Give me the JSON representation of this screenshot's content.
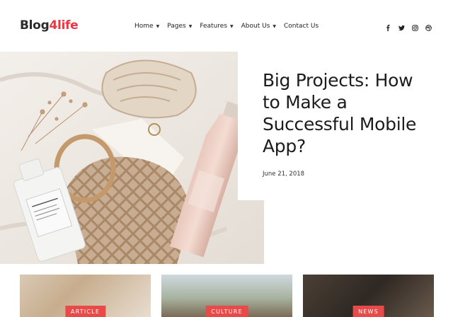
{
  "brand": {
    "name_main": "Blog",
    "name_accent": "4life",
    "accent_color": "#e63946"
  },
  "nav": [
    {
      "label": "Home",
      "has_dropdown": true
    },
    {
      "label": "Pages",
      "has_dropdown": true
    },
    {
      "label": "Features",
      "has_dropdown": true
    },
    {
      "label": "About Us",
      "has_dropdown": true
    },
    {
      "label": "Contact Us",
      "has_dropdown": false
    }
  ],
  "social": [
    {
      "icon": "facebook-icon"
    },
    {
      "icon": "twitter-icon"
    },
    {
      "icon": "instagram-icon"
    },
    {
      "icon": "dribbble-icon"
    }
  ],
  "hero": {
    "title": "Big Projects: How to Make a Successful Mobile App?",
    "date": "June 21, 2018"
  },
  "cards": [
    {
      "category": "Article"
    },
    {
      "category": "Culture"
    },
    {
      "category": "News"
    }
  ],
  "colors": {
    "badge": "#e84a4a",
    "text": "#1c1c1c"
  }
}
